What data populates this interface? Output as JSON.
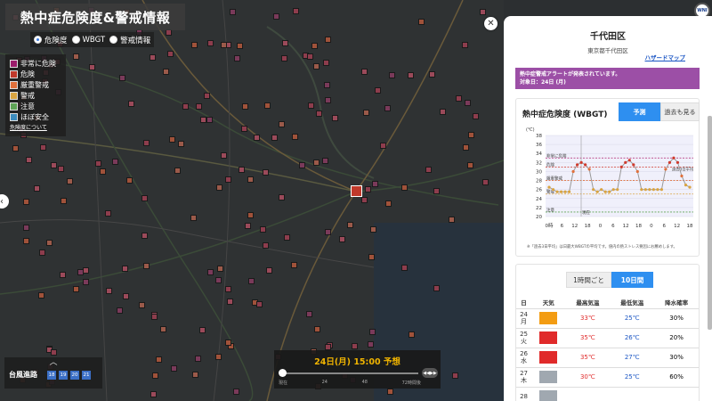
{
  "map": {
    "title": "熱中症危険度&警戒情報",
    "modes": [
      {
        "label": "危険度",
        "selected": true
      },
      {
        "label": "WBGT",
        "selected": false
      },
      {
        "label": "警戒情報",
        "selected": false
      }
    ],
    "legend": [
      {
        "label": "非常に危険",
        "color": "#9b1d6b"
      },
      {
        "label": "危険",
        "color": "#c0392b"
      },
      {
        "label": "厳重警戒",
        "color": "#e0703b"
      },
      {
        "label": "警戒",
        "color": "#d9a441"
      },
      {
        "label": "注意",
        "color": "#5fa356"
      },
      {
        "label": "ほぼ安全",
        "color": "#3c8bbd"
      }
    ],
    "legend_link": "危険度について",
    "typhoon": {
      "label": "台風進路",
      "days": [
        "18",
        "19",
        "20",
        "21"
      ]
    },
    "timebar": {
      "time": "24日(月) 15:00 予想",
      "ticks": [
        "現在",
        "24",
        "48",
        "72時間後"
      ],
      "play_icon": "play-forward-icon"
    }
  },
  "panel": {
    "city": "千代田区",
    "address": "東京都千代田区",
    "hazard_link": "ハザードマップ",
    "alert_line1": "熱中症警戒アラートが発表されています。",
    "alert_line2": "対象日：24日 (月)",
    "risk_card": {
      "title": "熱中症危険度 (WBGT)",
      "tab_forecast": "予測",
      "tab_past": "過去も見る",
      "note": "※「過去3日平均」は日最大WBGTの平均です。値内の熱ストレス要因にお薦めします。"
    },
    "forecast": {
      "tab_hourly": "1時間ごと",
      "tab_10day": "10日間",
      "headers": [
        "日",
        "天気",
        "最高気温",
        "最低気温",
        "降水確率"
      ],
      "rows": [
        {
          "date": "24",
          "dow": "月",
          "icon": "sun-icon",
          "hi": "33℃",
          "lo": "25℃",
          "pop": "30%"
        },
        {
          "date": "25",
          "dow": "火",
          "icon": "hot-sun-icon",
          "hi": "35℃",
          "lo": "26℃",
          "pop": "20%"
        },
        {
          "date": "26",
          "dow": "水",
          "icon": "hot-sun-cloud-icon",
          "hi": "35℃",
          "lo": "27℃",
          "pop": "30%"
        },
        {
          "date": "27",
          "dow": "木",
          "icon": "cloud-rain-icon",
          "hi": "30℃",
          "lo": "25℃",
          "pop": "60%"
        },
        {
          "date": "28",
          "dow": "",
          "icon": "cloud-icon",
          "hi": "",
          "lo": "",
          "pop": ""
        }
      ]
    }
  },
  "chart_data": {
    "type": "line",
    "ylabel": "(℃)",
    "yticks": [
      20,
      22,
      24,
      26,
      28,
      30,
      32,
      34,
      36,
      38
    ],
    "ylim": [
      20,
      38
    ],
    "xticks": [
      "0時",
      "6",
      "12",
      "18",
      "0",
      "6",
      "12",
      "18",
      "0",
      "6",
      "12",
      "18"
    ],
    "thresholds": [
      {
        "label": "非常に危険",
        "value": 33,
        "color": "#b0246f"
      },
      {
        "label": "危険",
        "value": 31,
        "color": "#d0392b"
      },
      {
        "label": "厳重警戒",
        "value": 28,
        "color": "#e0703b"
      },
      {
        "label": "警戒",
        "value": 25,
        "color": "#d9a441"
      },
      {
        "label": "注意",
        "value": 21,
        "color": "#5fa356"
      }
    ],
    "past_avg_label": "過去3日平均",
    "now_label": "現在",
    "series": [
      {
        "values": [
          26.5,
          26,
          25.5,
          25.5,
          25.5,
          25.5,
          30,
          31.5,
          32,
          31.5,
          30.5,
          26,
          25.5,
          26,
          25.5,
          25.5,
          26,
          26,
          31,
          32,
          32.5,
          31.5,
          30,
          26,
          26,
          26,
          26,
          26,
          26,
          30.5,
          32,
          33,
          32,
          29,
          27,
          26.5
        ]
      }
    ]
  }
}
